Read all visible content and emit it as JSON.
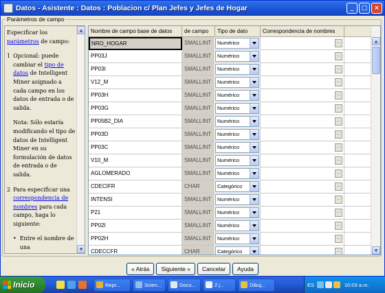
{
  "window": {
    "title": "Datos - Asistente : Datos : Poblacion c/ Plan Jefes y Jefes de Hogar",
    "controls": {
      "minimize": "_",
      "maximize": "□",
      "close": "×"
    }
  },
  "group": {
    "label": "Parámetros de campo"
  },
  "help": {
    "p1_pre": "Especificar los ",
    "p1_link": "parámetros",
    "p1_post": " de campo:",
    "s1_num": "1",
    "s1_pre": "Opcional: puede cambiar el ",
    "s1_link": "tipo de datos",
    "s1_post": " de Intelligent Miner asignado a cada campo en los datos de entrada o de salida.",
    "note": "Nota: Sólo estaría modificando el tipo de datos de Intelligent Miner en su formulación de datos de entrada o de salida.",
    "s2_num": "2",
    "s2_pre": "Para especificar una ",
    "s2_link": "correspondencia de nombres",
    "s2_post": " para cada campo, haga lo siguiente:",
    "bullet": "Entre el nombre de una"
  },
  "grid": {
    "headers": [
      "Nombre de campo base de datos",
      "de campo",
      "Tipo de dato",
      "Correspondencia de nombres"
    ],
    "rows": [
      {
        "name": "NRO_HOGAR",
        "type": "SMALLINT",
        "dtype": "Numérico"
      },
      {
        "name": "PP03J",
        "type": "SMALLINT",
        "dtype": "Numérico"
      },
      {
        "name": "PP03I",
        "type": "SMALLINT",
        "dtype": "Numérico"
      },
      {
        "name": "V12_M",
        "type": "SMALLINT",
        "dtype": "Numérico"
      },
      {
        "name": "PP03H",
        "type": "SMALLINT",
        "dtype": "Numérico"
      },
      {
        "name": "PP03G",
        "type": "SMALLINT",
        "dtype": "Numérico"
      },
      {
        "name": "PP05B2_DIA",
        "type": "SMALLINT",
        "dtype": "Numérico"
      },
      {
        "name": "PP03D",
        "type": "SMALLINT",
        "dtype": "Numérico"
      },
      {
        "name": "PP03C",
        "type": "SMALLINT",
        "dtype": "Numérico"
      },
      {
        "name": "V10_M",
        "type": "SMALLINT",
        "dtype": "Numérico"
      },
      {
        "name": "AGLOMERADO",
        "type": "SMALLINT",
        "dtype": "Numérico"
      },
      {
        "name": "CDECIFR",
        "type": "CHAR",
        "dtype": "Categórico"
      },
      {
        "name": "INTENSI",
        "type": "SMALLINT",
        "dtype": "Numérico"
      },
      {
        "name": "P21",
        "type": "SMALLINT",
        "dtype": "Numérico"
      },
      {
        "name": "PP02I",
        "type": "SMALLINT",
        "dtype": "Numérico"
      },
      {
        "name": "PP02H",
        "type": "SMALLINT",
        "dtype": "Numérico"
      },
      {
        "name": "CDECCFR",
        "type": "CHAR",
        "dtype": "Categórico"
      }
    ],
    "corr_button": "..."
  },
  "buttons": {
    "back": "« Atrás",
    "next": "Siguiente »",
    "cancel": "Cancelar",
    "help": "Ayuda"
  },
  "taskbar": {
    "start": "Inicio",
    "tasks": [
      {
        "label": "Repr...",
        "color": "#E8B030"
      },
      {
        "label": "Scien...",
        "color": "#9AB8E8"
      },
      {
        "label": "Docu...",
        "color": "#E8E8E8"
      },
      {
        "label": "2 j...",
        "color": "#F0F0F0"
      },
      {
        "label": "Dibuj...",
        "color": "#E8C040"
      }
    ],
    "lang": "ES",
    "clock": "10:03 a.m."
  }
}
